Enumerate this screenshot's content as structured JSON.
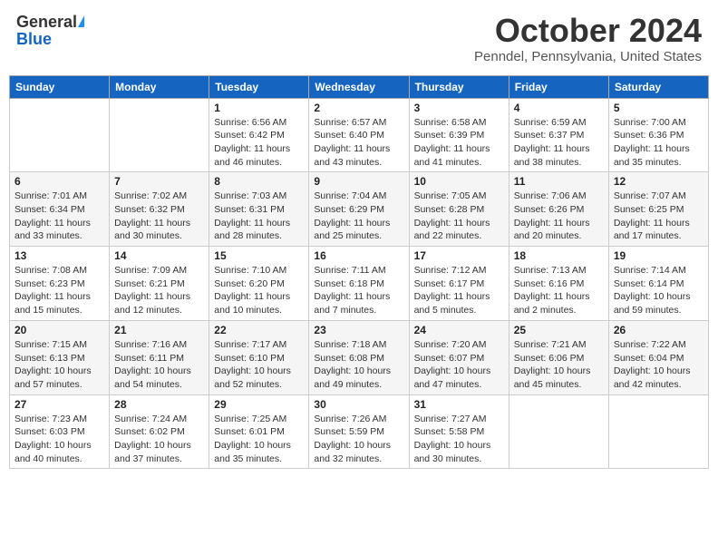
{
  "header": {
    "logo_general": "General",
    "logo_blue": "Blue",
    "month_title": "October 2024",
    "location": "Penndel, Pennsylvania, United States"
  },
  "weekdays": [
    "Sunday",
    "Monday",
    "Tuesday",
    "Wednesday",
    "Thursday",
    "Friday",
    "Saturday"
  ],
  "weeks": [
    [
      {
        "day": "",
        "info": ""
      },
      {
        "day": "",
        "info": ""
      },
      {
        "day": "1",
        "info": "Sunrise: 6:56 AM\nSunset: 6:42 PM\nDaylight: 11 hours and 46 minutes."
      },
      {
        "day": "2",
        "info": "Sunrise: 6:57 AM\nSunset: 6:40 PM\nDaylight: 11 hours and 43 minutes."
      },
      {
        "day": "3",
        "info": "Sunrise: 6:58 AM\nSunset: 6:39 PM\nDaylight: 11 hours and 41 minutes."
      },
      {
        "day": "4",
        "info": "Sunrise: 6:59 AM\nSunset: 6:37 PM\nDaylight: 11 hours and 38 minutes."
      },
      {
        "day": "5",
        "info": "Sunrise: 7:00 AM\nSunset: 6:36 PM\nDaylight: 11 hours and 35 minutes."
      }
    ],
    [
      {
        "day": "6",
        "info": "Sunrise: 7:01 AM\nSunset: 6:34 PM\nDaylight: 11 hours and 33 minutes."
      },
      {
        "day": "7",
        "info": "Sunrise: 7:02 AM\nSunset: 6:32 PM\nDaylight: 11 hours and 30 minutes."
      },
      {
        "day": "8",
        "info": "Sunrise: 7:03 AM\nSunset: 6:31 PM\nDaylight: 11 hours and 28 minutes."
      },
      {
        "day": "9",
        "info": "Sunrise: 7:04 AM\nSunset: 6:29 PM\nDaylight: 11 hours and 25 minutes."
      },
      {
        "day": "10",
        "info": "Sunrise: 7:05 AM\nSunset: 6:28 PM\nDaylight: 11 hours and 22 minutes."
      },
      {
        "day": "11",
        "info": "Sunrise: 7:06 AM\nSunset: 6:26 PM\nDaylight: 11 hours and 20 minutes."
      },
      {
        "day": "12",
        "info": "Sunrise: 7:07 AM\nSunset: 6:25 PM\nDaylight: 11 hours and 17 minutes."
      }
    ],
    [
      {
        "day": "13",
        "info": "Sunrise: 7:08 AM\nSunset: 6:23 PM\nDaylight: 11 hours and 15 minutes."
      },
      {
        "day": "14",
        "info": "Sunrise: 7:09 AM\nSunset: 6:21 PM\nDaylight: 11 hours and 12 minutes."
      },
      {
        "day": "15",
        "info": "Sunrise: 7:10 AM\nSunset: 6:20 PM\nDaylight: 11 hours and 10 minutes."
      },
      {
        "day": "16",
        "info": "Sunrise: 7:11 AM\nSunset: 6:18 PM\nDaylight: 11 hours and 7 minutes."
      },
      {
        "day": "17",
        "info": "Sunrise: 7:12 AM\nSunset: 6:17 PM\nDaylight: 11 hours and 5 minutes."
      },
      {
        "day": "18",
        "info": "Sunrise: 7:13 AM\nSunset: 6:16 PM\nDaylight: 11 hours and 2 minutes."
      },
      {
        "day": "19",
        "info": "Sunrise: 7:14 AM\nSunset: 6:14 PM\nDaylight: 10 hours and 59 minutes."
      }
    ],
    [
      {
        "day": "20",
        "info": "Sunrise: 7:15 AM\nSunset: 6:13 PM\nDaylight: 10 hours and 57 minutes."
      },
      {
        "day": "21",
        "info": "Sunrise: 7:16 AM\nSunset: 6:11 PM\nDaylight: 10 hours and 54 minutes."
      },
      {
        "day": "22",
        "info": "Sunrise: 7:17 AM\nSunset: 6:10 PM\nDaylight: 10 hours and 52 minutes."
      },
      {
        "day": "23",
        "info": "Sunrise: 7:18 AM\nSunset: 6:08 PM\nDaylight: 10 hours and 49 minutes."
      },
      {
        "day": "24",
        "info": "Sunrise: 7:20 AM\nSunset: 6:07 PM\nDaylight: 10 hours and 47 minutes."
      },
      {
        "day": "25",
        "info": "Sunrise: 7:21 AM\nSunset: 6:06 PM\nDaylight: 10 hours and 45 minutes."
      },
      {
        "day": "26",
        "info": "Sunrise: 7:22 AM\nSunset: 6:04 PM\nDaylight: 10 hours and 42 minutes."
      }
    ],
    [
      {
        "day": "27",
        "info": "Sunrise: 7:23 AM\nSunset: 6:03 PM\nDaylight: 10 hours and 40 minutes."
      },
      {
        "day": "28",
        "info": "Sunrise: 7:24 AM\nSunset: 6:02 PM\nDaylight: 10 hours and 37 minutes."
      },
      {
        "day": "29",
        "info": "Sunrise: 7:25 AM\nSunset: 6:01 PM\nDaylight: 10 hours and 35 minutes."
      },
      {
        "day": "30",
        "info": "Sunrise: 7:26 AM\nSunset: 5:59 PM\nDaylight: 10 hours and 32 minutes."
      },
      {
        "day": "31",
        "info": "Sunrise: 7:27 AM\nSunset: 5:58 PM\nDaylight: 10 hours and 30 minutes."
      },
      {
        "day": "",
        "info": ""
      },
      {
        "day": "",
        "info": ""
      }
    ]
  ]
}
